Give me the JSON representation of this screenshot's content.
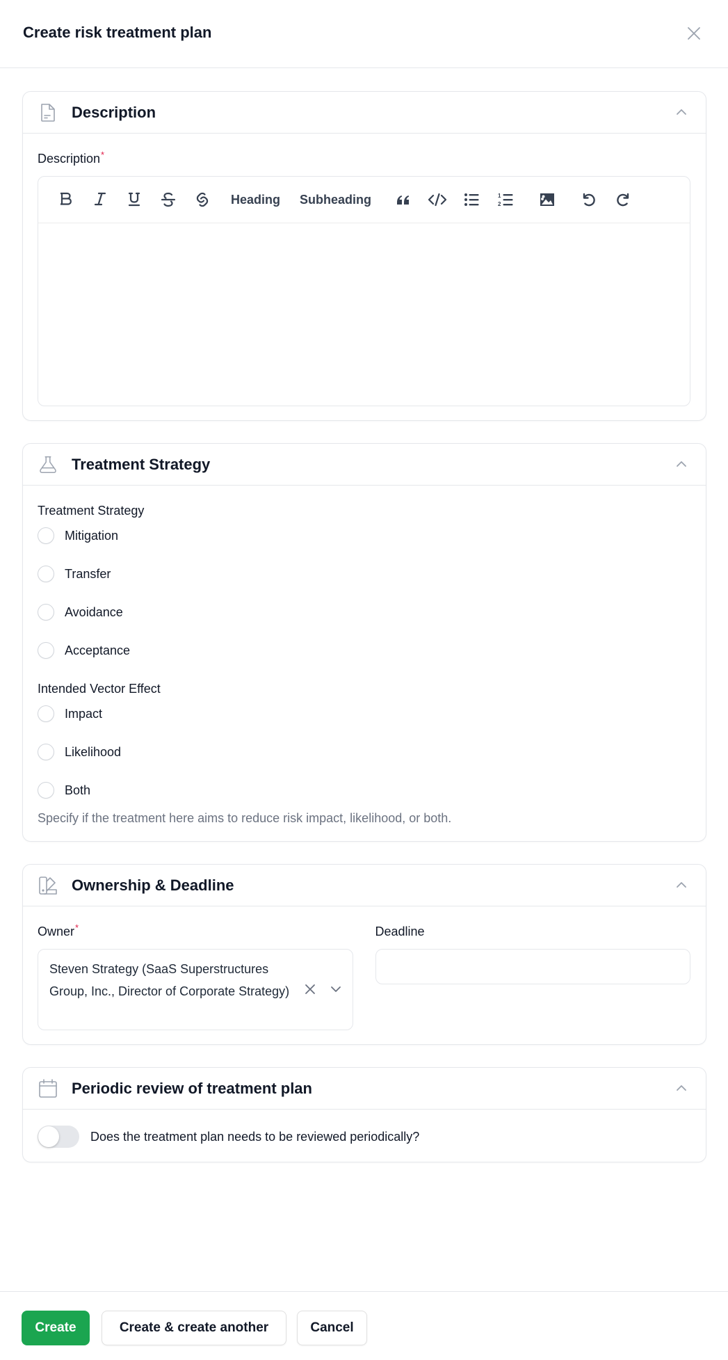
{
  "header": {
    "title": "Create risk treatment plan",
    "close_icon": "close-icon"
  },
  "sections": {
    "description": {
      "title": "Description",
      "icon": "document-icon",
      "field_label": "Description",
      "required_mark": "*",
      "toolbar": {
        "bold": "bold-icon",
        "italic": "italic-icon",
        "underline": "underline-icon",
        "strikethrough": "strikethrough-icon",
        "link": "link-icon",
        "heading_label": "Heading",
        "subheading_label": "Subheading",
        "quote": "quote-icon",
        "code": "code-icon",
        "bullet_list": "bullet-list-icon",
        "ordered_list": "ordered-list-icon",
        "image": "image-icon",
        "undo": "undo-icon",
        "redo": "redo-icon"
      },
      "editor_value": ""
    },
    "treatment_strategy": {
      "title": "Treatment Strategy",
      "icon": "flask-icon",
      "strategy_label": "Treatment Strategy",
      "strategy_options": [
        "Mitigation",
        "Transfer",
        "Avoidance",
        "Acceptance"
      ],
      "strategy_selected": null,
      "vector_label": "Intended Vector Effect",
      "vector_options": [
        "Impact",
        "Likelihood",
        "Both"
      ],
      "vector_selected": null,
      "helper_text": "Specify if the treatment here aims to reduce risk impact, likelihood, or both."
    },
    "ownership": {
      "title": "Ownership & Deadline",
      "icon": "swatch-icon",
      "owner_label": "Owner",
      "required_mark": "*",
      "owner_value": "Steven Strategy (SaaS Superstructures Group, Inc., Director of Corporate Strategy)",
      "deadline_label": "Deadline",
      "deadline_value": ""
    },
    "periodic_review": {
      "title": "Periodic review of treatment plan",
      "icon": "calendar-icon",
      "toggle_label": "Does the treatment plan needs to be reviewed periodically?",
      "toggle_on": false
    }
  },
  "footer": {
    "create_label": "Create",
    "create_another_label": "Create & create another",
    "cancel_label": "Cancel"
  },
  "colors": {
    "primary": "#1ba550",
    "required": "#e11d48",
    "helper_text": "#6b7280",
    "border": "#e5e7eb"
  }
}
